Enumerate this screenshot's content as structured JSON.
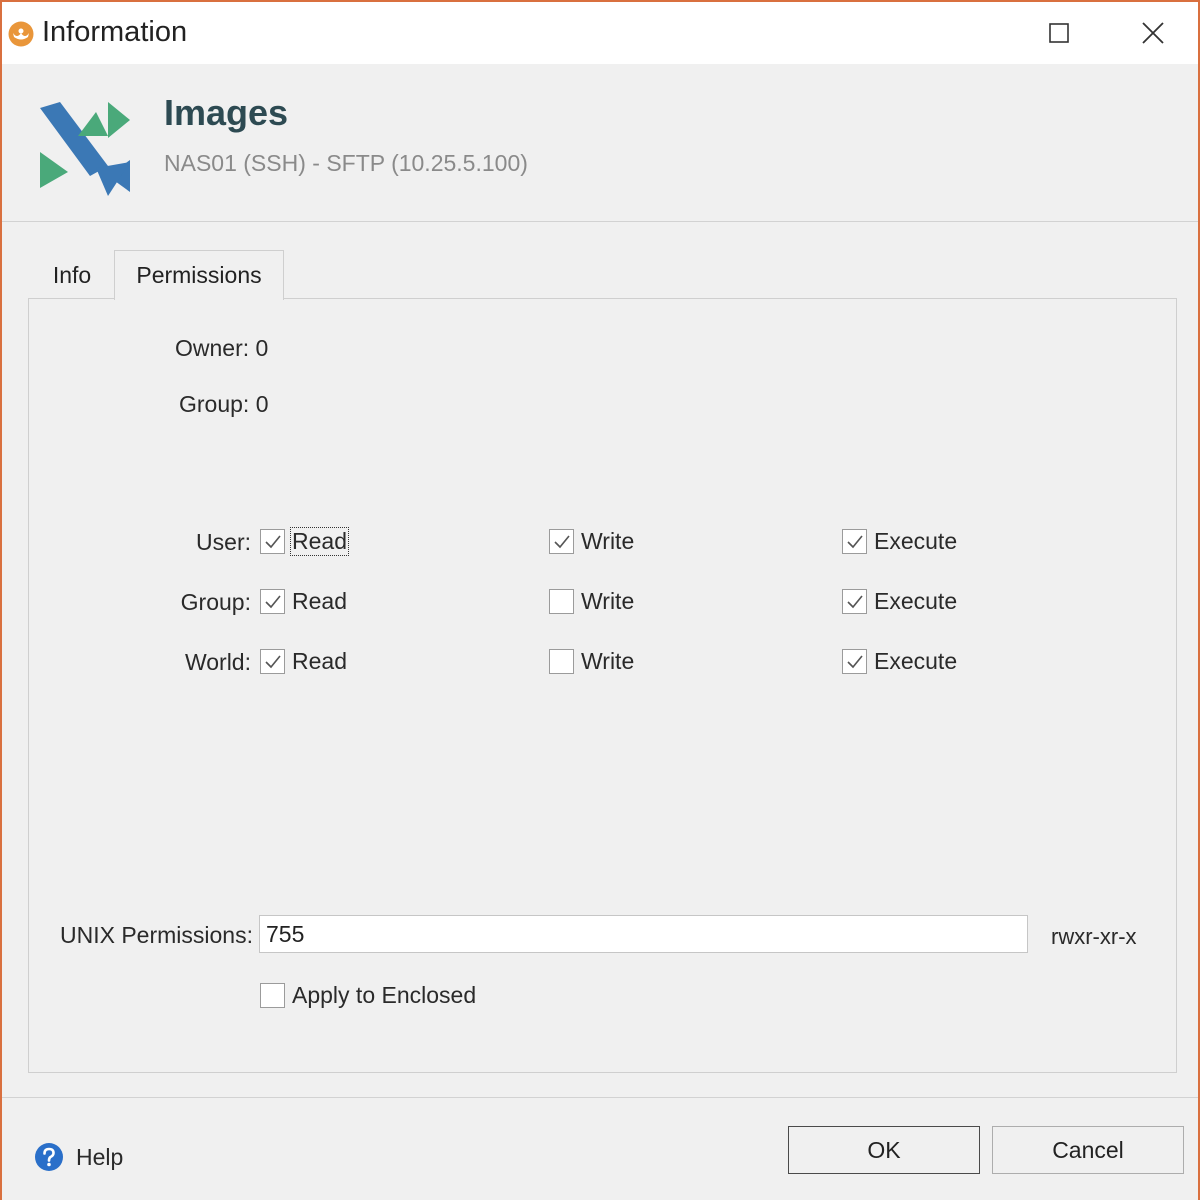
{
  "window": {
    "title": "Information"
  },
  "header": {
    "title": "Images",
    "subtitle": "NAS01 (SSH) - SFTP (10.25.5.100)"
  },
  "tabs": [
    {
      "label": "Info",
      "active": false
    },
    {
      "label": "Permissions",
      "active": true
    }
  ],
  "permissions": {
    "owner_label": "Owner: 0",
    "group_label": "Group: 0",
    "rows": [
      {
        "label": "User:",
        "read": {
          "label": "Read",
          "checked": true
        },
        "write": {
          "label": "Write",
          "checked": true
        },
        "execute": {
          "label": "Execute",
          "checked": true
        }
      },
      {
        "label": "Group:",
        "read": {
          "label": "Read",
          "checked": true
        },
        "write": {
          "label": "Write",
          "checked": false
        },
        "execute": {
          "label": "Execute",
          "checked": true
        }
      },
      {
        "label": "World:",
        "read": {
          "label": "Read",
          "checked": true
        },
        "write": {
          "label": "Write",
          "checked": false
        },
        "execute": {
          "label": "Execute",
          "checked": true
        }
      }
    ],
    "unix_label": "UNIX Permissions:",
    "unix_value": "755",
    "unix_symbolic": "rwxr-xr-x",
    "apply_enclosed": {
      "label": "Apply to Enclosed",
      "checked": false
    }
  },
  "footer": {
    "help_label": "Help",
    "ok_label": "OK",
    "cancel_label": "Cancel"
  },
  "colors": {
    "window_border": "#d9703f",
    "logo_blue": "#3b78b5",
    "logo_green": "#4aa97a",
    "help_blue": "#2a6fc9"
  }
}
